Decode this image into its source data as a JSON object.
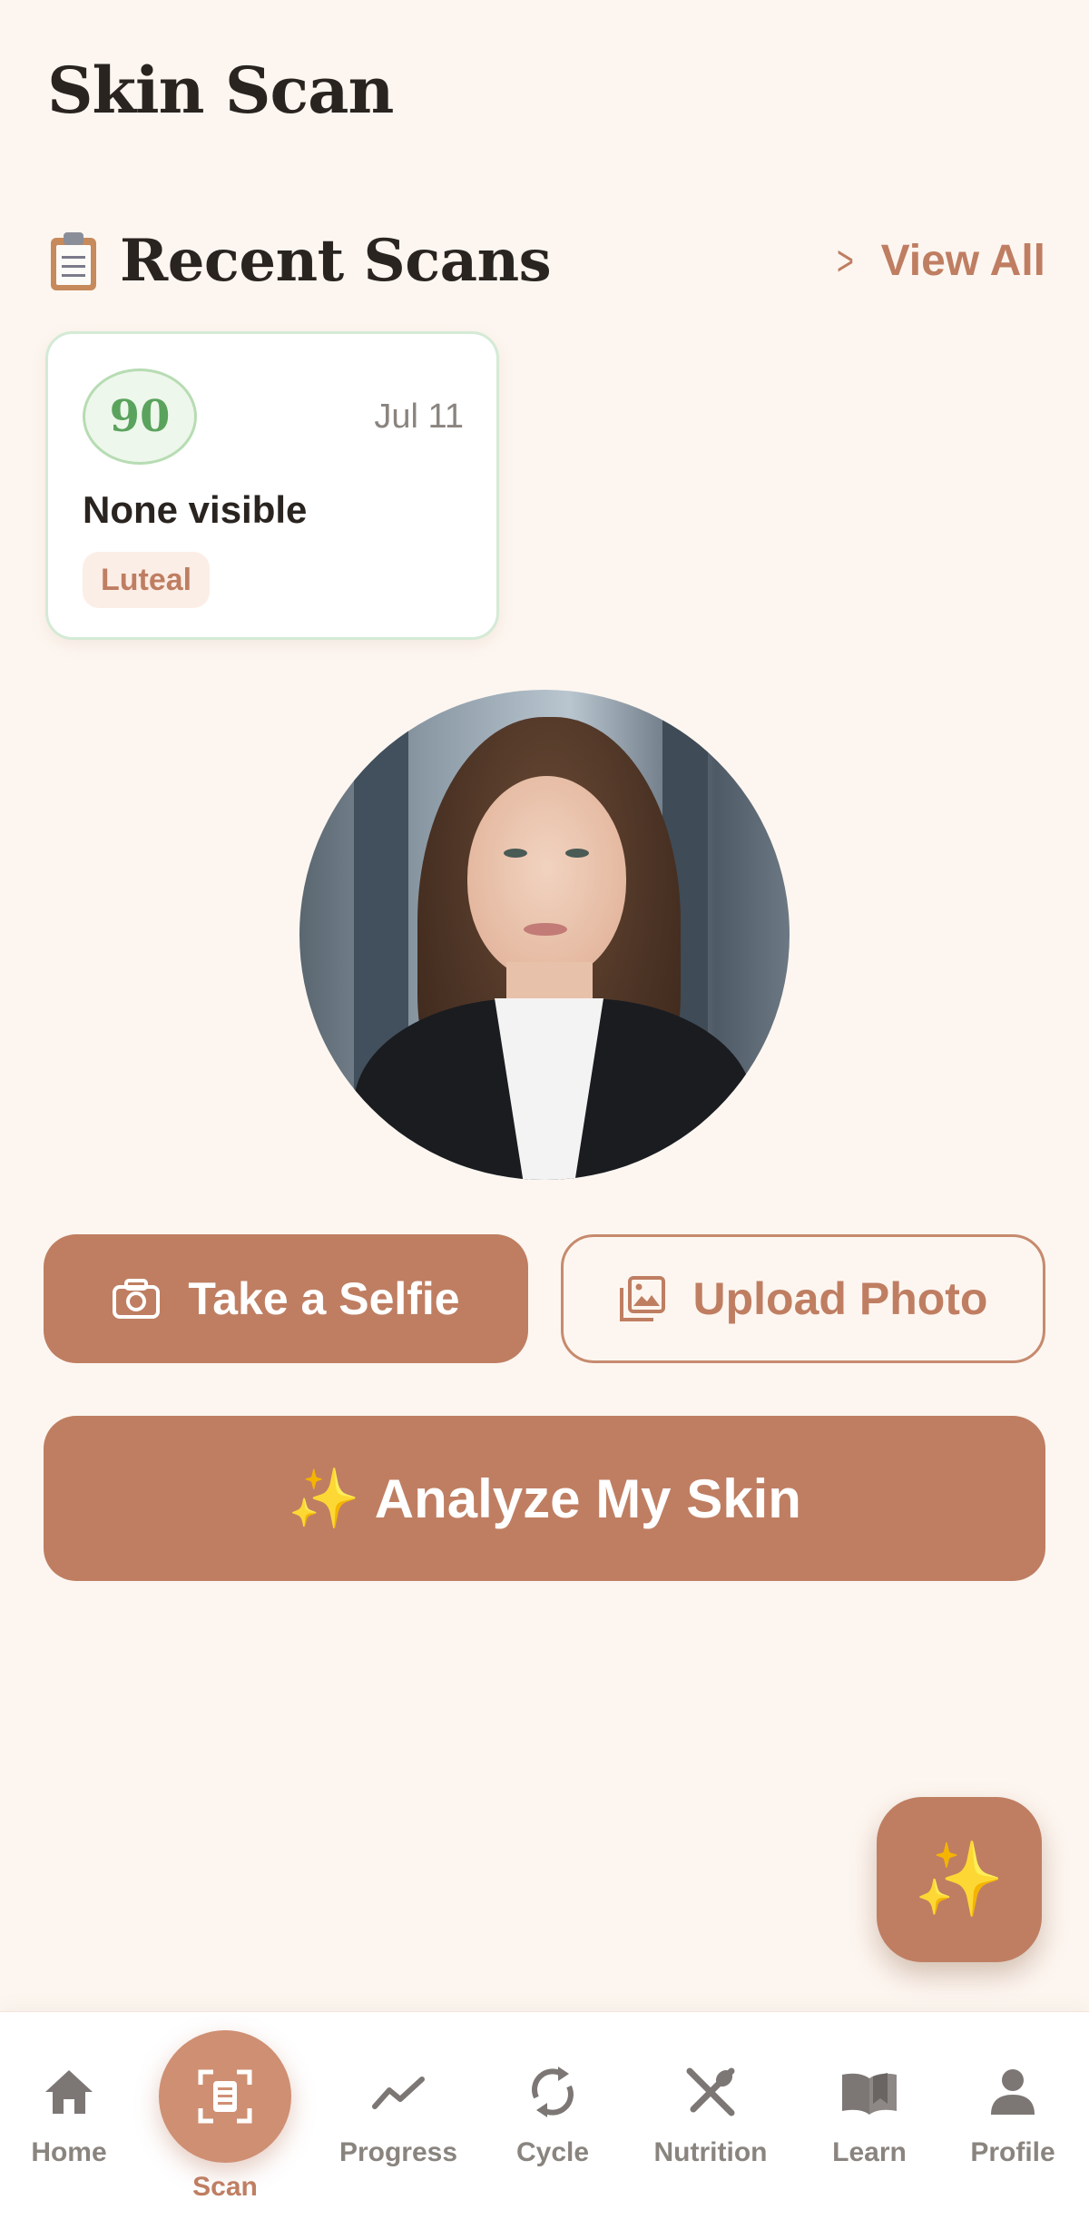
{
  "header": {
    "title": "Skin Scan"
  },
  "recent_scans": {
    "title": "Recent Scans",
    "icon": "clipboard-icon",
    "view_all_label": "View All",
    "items": [
      {
        "score": "90",
        "date": "Jul 11",
        "description": "None visible",
        "phase": "Luteal"
      }
    ]
  },
  "photo": {
    "alt": "selfie-preview"
  },
  "actions": {
    "selfie_label": "Take a Selfie",
    "upload_label": "Upload Photo",
    "analyze_label": "Analyze My Skin"
  },
  "fab": {
    "icon": "sparkles-icon"
  },
  "nav": {
    "items": [
      {
        "label": "Home",
        "icon": "home-icon"
      },
      {
        "label": "Scan",
        "icon": "scan-icon",
        "active": true
      },
      {
        "label": "Progress",
        "icon": "trend-icon"
      },
      {
        "label": "Cycle",
        "icon": "cycle-icon"
      },
      {
        "label": "Nutrition",
        "icon": "utensils-icon"
      },
      {
        "label": "Learn",
        "icon": "book-icon"
      },
      {
        "label": "Profile",
        "icon": "person-icon"
      }
    ]
  },
  "colors": {
    "accent": "#bf7e62",
    "background": "#fdf6f0",
    "score_green": "#5aa35d",
    "sparkle": "#f2c84b"
  }
}
